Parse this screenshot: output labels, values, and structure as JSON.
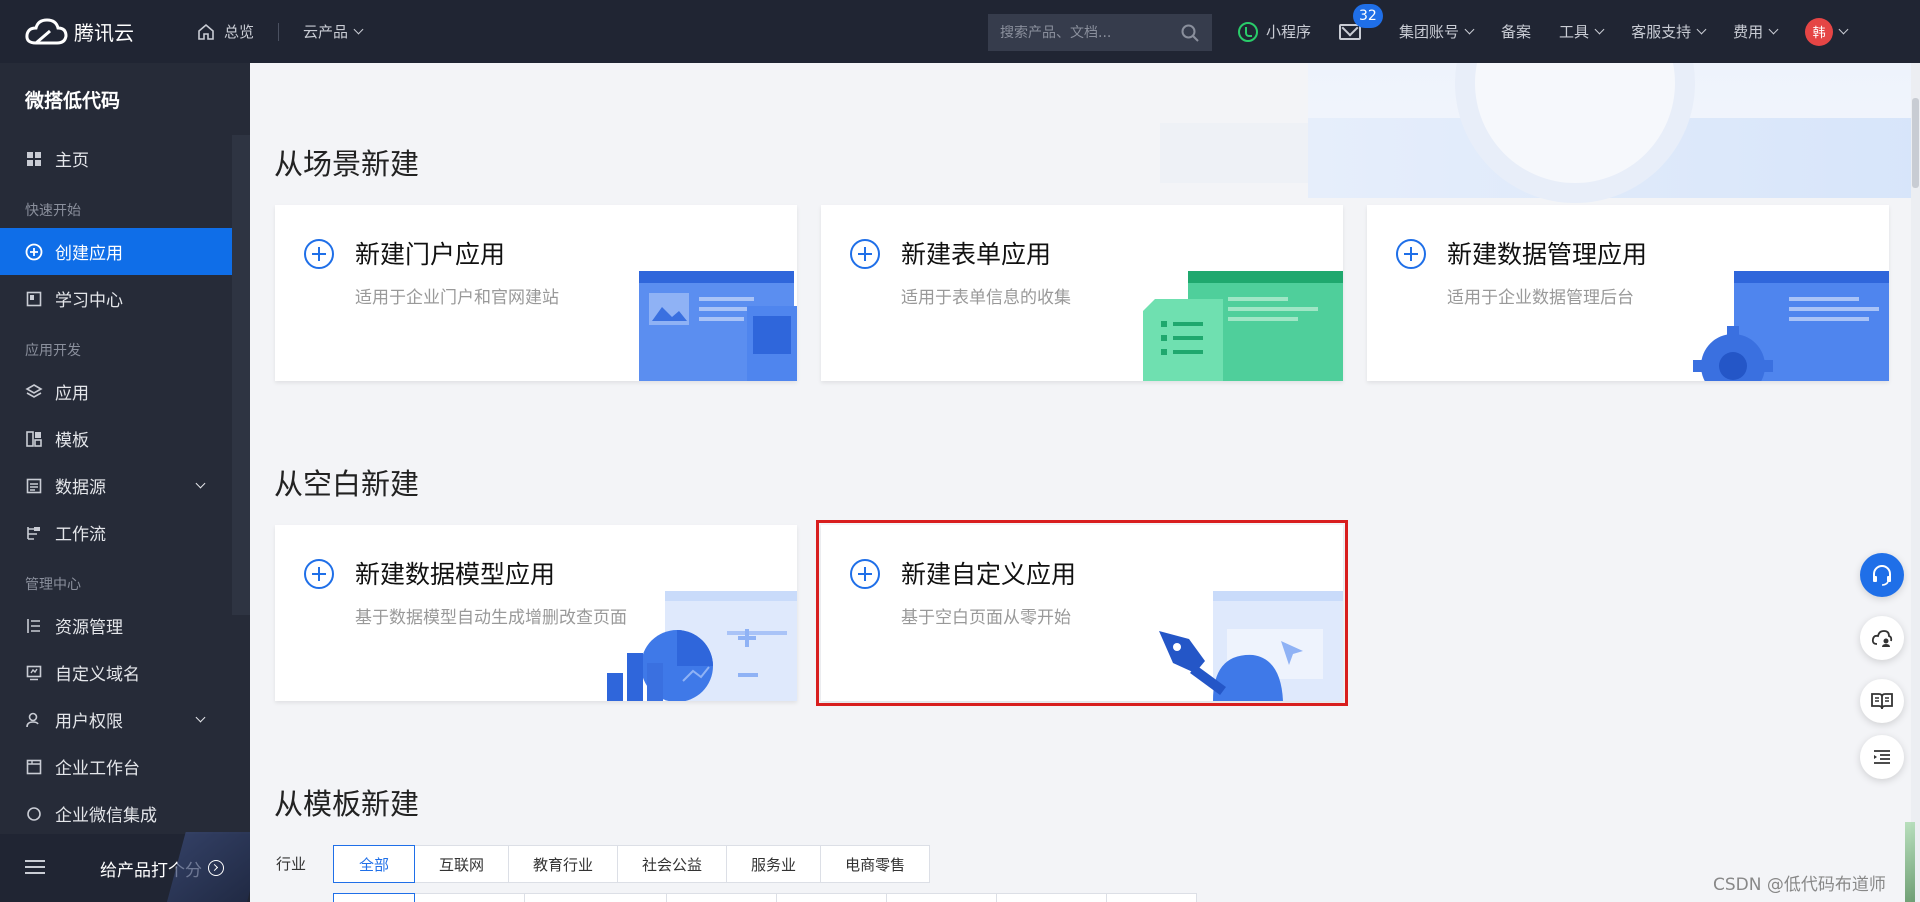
{
  "topbar": {
    "brand": "腾讯云",
    "home": "总览",
    "products": "云产品",
    "search_placeholder": "搜索产品、文档...",
    "miniprogram": "小程序",
    "mail_badge": "32",
    "group_account": "集团账号",
    "filing": "备案",
    "tools": "工具",
    "support": "客服支持",
    "billing": "费用",
    "avatar_text": "韩"
  },
  "sidebar": {
    "title": "微搭低代码",
    "home": "主页",
    "group_quickstart": "快速开始",
    "create_app": "创建应用",
    "learning": "学习中心",
    "group_dev": "应用开发",
    "apps": "应用",
    "templates": "模板",
    "datasource": "数据源",
    "workflow": "工作流",
    "group_manage": "管理中心",
    "resources": "资源管理",
    "custom_domain": "自定义域名",
    "permissions": "用户权限",
    "workbench": "企业工作台",
    "wecom": "企业微信集成",
    "rate": "给产品打个分"
  },
  "main": {
    "scene_title": "从场景新建",
    "scene_cards": [
      {
        "title": "新建门户应用",
        "desc": "适用于企业门户和官网建站"
      },
      {
        "title": "新建表单应用",
        "desc": "适用于表单信息的收集"
      },
      {
        "title": "新建数据管理应用",
        "desc": "适用于企业数据管理后台"
      }
    ],
    "blank_title": "从空白新建",
    "blank_cards": [
      {
        "title": "新建数据模型应用",
        "desc": "基于数据模型自动生成增删改查页面"
      },
      {
        "title": "新建自定义应用",
        "desc": "基于空白页面从零开始"
      }
    ],
    "template_title": "从模板新建",
    "industry_label": "行业",
    "industry_tabs": [
      "全部",
      "互联网",
      "教育行业",
      "社会公益",
      "服务业",
      "电商零售"
    ]
  },
  "watermark": "CSDN @低代码布道师",
  "colors": {
    "accent": "#1f6fe8",
    "highlight": "#d81e1e",
    "topbar": "#202533",
    "sidebar": "#262b38"
  }
}
